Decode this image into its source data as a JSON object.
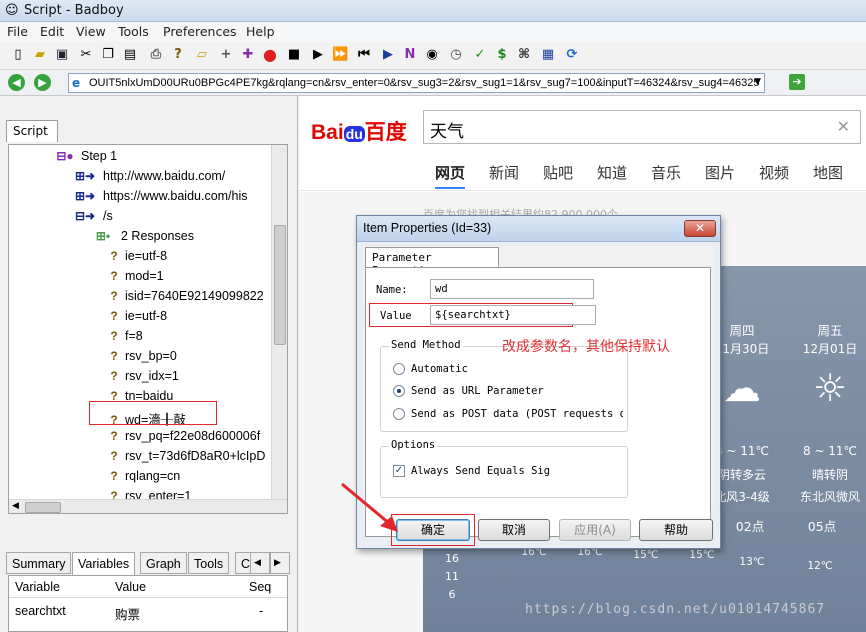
{
  "window": {
    "title": "Script - Badboy"
  },
  "menu": [
    "File",
    "Edit",
    "View",
    "Tools",
    "Preferences",
    "Help"
  ],
  "address": {
    "url": "OUIT5nlxUmD00URu0BPGc4PE7kg&rqlang=cn&rsv_enter=0&rsv_sug3=2&rsv_sug1=1&rsv_sug7=100&inputT=46324&rsv_sug4=46325"
  },
  "left": {
    "script_tab": "Script",
    "tree": [
      {
        "label": "Step 1",
        "icon": "step-icon"
      },
      {
        "label": "http://www.baidu.com/",
        "icon": "request-arrow-icon"
      },
      {
        "label": "https://www.baidu.com/his",
        "icon": "request-arrow-icon"
      },
      {
        "label": "/s",
        "icon": "request-arrow-icon"
      },
      {
        "label": "2 Responses",
        "icon": "response-dot-icon"
      },
      {
        "label": "ie=utf-8",
        "icon": "param-icon"
      },
      {
        "label": "mod=1",
        "icon": "param-icon"
      },
      {
        "label": "isid=7640E92149099822",
        "icon": "param-icon"
      },
      {
        "label": "ie=utf-8",
        "icon": "param-icon"
      },
      {
        "label": "f=8",
        "icon": "param-icon"
      },
      {
        "label": "rsv_bp=0",
        "icon": "param-icon"
      },
      {
        "label": "rsv_idx=1",
        "icon": "param-icon"
      },
      {
        "label": "tn=baidu",
        "icon": "param-icon"
      },
      {
        "label": "wd=濇╂敼",
        "icon": "param-icon"
      },
      {
        "label": "rsv_pq=f22e08d600006f",
        "icon": "param-icon"
      },
      {
        "label": "rsv_t=73d6fD8aR0+lcIpD",
        "icon": "param-icon"
      },
      {
        "label": "rqlang=cn",
        "icon": "param-icon"
      },
      {
        "label": "rsv_enter=1",
        "icon": "param-icon"
      }
    ],
    "bottom_tabs": [
      "Summary",
      "Variables",
      "Graph",
      "Tools",
      "C"
    ],
    "variables": {
      "headers": [
        "Variable",
        "Value",
        "Seq"
      ],
      "rows": [
        {
          "variable": "searchtxt",
          "value": "购票",
          "seq": "-"
        }
      ]
    }
  },
  "browser": {
    "logo": {
      "bai": "Bai",
      "du": "du",
      "cn": "百度"
    },
    "query": "天气",
    "nav": [
      "网页",
      "新闻",
      "贴吧",
      "知道",
      "音乐",
      "图片",
      "视频",
      "地图"
    ],
    "snippet": "百度为您找到相关结果约82,900,000个",
    "weather": {
      "days": [
        {
          "day": "周四",
          "date": "11月30日",
          "temp": "3 ~ 11℃",
          "desc": "阴转多云",
          "wind": "北风3-4级"
        },
        {
          "day": "周五",
          "date": "12月01日",
          "temp": "8 ~ 11℃",
          "desc": "晴转阴",
          "wind": "东北风微风"
        }
      ],
      "hours": [
        "02点",
        "05点"
      ],
      "hour_temps": [
        "13℃",
        "12℃"
      ],
      "row_temps": [
        "16℃",
        "16℃",
        "15℃",
        "15℃"
      ],
      "side_nums": [
        "16",
        "11",
        "6"
      ]
    }
  },
  "dialog": {
    "title": "Item Properties (Id=33)",
    "close": "✕",
    "tab": "Parameter Properties",
    "name_label": "Name:",
    "name_value": "wd",
    "value_label": "Value",
    "value_value": "${searchtxt}",
    "send_method_label": "Send Method",
    "radio_automatic": "Automatic",
    "radio_url": "Send as URL Parameter",
    "radio_post": "Send as POST data (POST requests o",
    "options_label": "Options",
    "checkbox_label": "Always Send Equals Sig",
    "buttons": {
      "ok": "确定",
      "cancel": "取消",
      "apply": "应用(A)",
      "help": "帮助"
    }
  },
  "annotation": "改成参数名，其他保持默认",
  "watermark": "https://blog.csdn.net/u01014745867",
  "colors": {
    "highlight": "#e2262b",
    "baidu_blue": "#2932e1",
    "baidu_red": "#e10602"
  }
}
